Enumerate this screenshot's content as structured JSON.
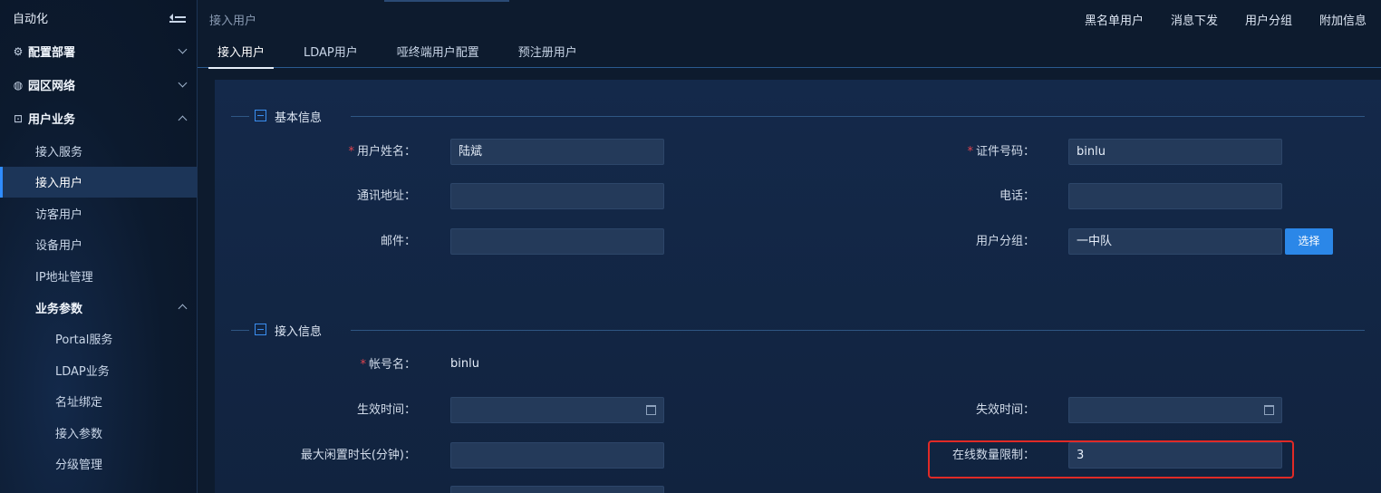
{
  "sidebar": {
    "title": "自动化",
    "groups": [
      {
        "label": "配置部署",
        "icon": "gear-icon"
      },
      {
        "label": "园区网络",
        "icon": "globe-icon"
      },
      {
        "label": "用户业务",
        "icon": "user-business-icon"
      }
    ],
    "items": [
      "接入服务",
      "接入用户",
      "访客用户",
      "设备用户",
      "IP地址管理"
    ],
    "sub_group": "业务参数",
    "sub_items": [
      "Portal服务",
      "LDAP业务",
      "名址绑定",
      "接入参数",
      "分级管理"
    ]
  },
  "header": {
    "breadcrumb": "接入用户",
    "actions": [
      "黑名单用户",
      "消息下发",
      "用户分组",
      "附加信息"
    ]
  },
  "tabs": [
    "接入用户",
    "LDAP用户",
    "哑终端用户配置",
    "预注册用户"
  ],
  "basic": {
    "title": "基本信息",
    "name_label": "用户姓名",
    "name_value": "陆斌",
    "id_label": "证件号码",
    "id_value": "binlu",
    "address_label": "通讯地址",
    "address_value": "",
    "phone_label": "电话",
    "phone_value": "",
    "email_label": "邮件",
    "email_value": "",
    "group_label": "用户分组",
    "group_value": "一中队",
    "select_button": "选择"
  },
  "access": {
    "title": "接入信息",
    "account_label": "帐号名",
    "account_value": "binlu",
    "start_label": "生效时间",
    "end_label": "失效时间",
    "idle_label": "最大闲置时长(分钟)",
    "idle_value": "",
    "online_limit_label": "在线数量限制",
    "online_limit_value": "3"
  },
  "colors": {
    "accent": "#2b87e8",
    "required": "#e0444e",
    "highlight": "#e02a26"
  }
}
